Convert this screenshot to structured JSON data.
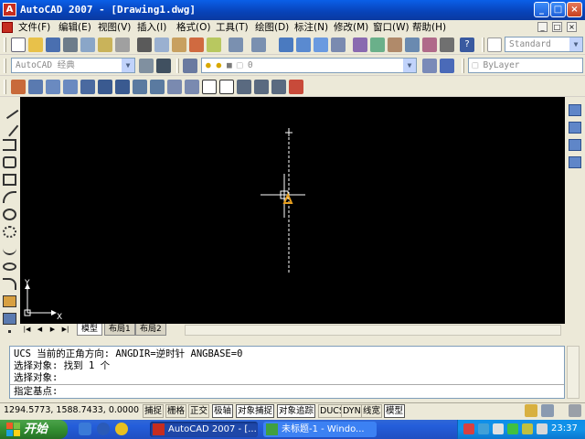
{
  "window": {
    "app_logo": "A",
    "title": "AutoCAD 2007 - [Drawing1.dwg]",
    "minimize": "_",
    "maximize": "□",
    "close": "×"
  },
  "menu": {
    "items": [
      "文件(F)",
      "编辑(E)",
      "视图(V)",
      "插入(I)",
      "格式(O)",
      "工具(T)",
      "绘图(D)",
      "标注(N)",
      "修改(M)",
      "窗口(W)",
      "帮助(H)"
    ],
    "mdi_buttons": [
      "_",
      "□",
      "×"
    ]
  },
  "toolbars": {
    "text_style_value": "Standard",
    "workspace_value": "AutoCAD 经典",
    "layer_value": "0",
    "color_value": "ByLayer"
  },
  "drawing": {
    "ucs_x_label": "X",
    "ucs_y_label": "Y"
  },
  "layout_tabs": {
    "nav": [
      "|◀",
      "◀",
      "▶",
      "▶|"
    ],
    "tabs": [
      "模型",
      "布局1",
      "布局2"
    ],
    "active": "模型"
  },
  "command_window": {
    "lines": [
      "UCS 当前的正角方向:  ANGDIR=逆时针  ANGBASE=0",
      "选择对象: 找到 1 个",
      "选择对象:",
      "指定基点:"
    ]
  },
  "statusbar": {
    "coordinates": "1294.5773, 1588.7433, 0.0000",
    "buttons": [
      {
        "label": "捕捉",
        "on": false
      },
      {
        "label": "栅格",
        "on": false
      },
      {
        "label": "正交",
        "on": false
      },
      {
        "label": "极轴",
        "on": true
      },
      {
        "label": "对象捕捉",
        "on": true
      },
      {
        "label": "对象追踪",
        "on": true
      },
      {
        "label": "DUCS",
        "on": false
      },
      {
        "label": "DYN",
        "on": false
      },
      {
        "label": "线宽",
        "on": false
      },
      {
        "label": "模型",
        "on": true
      }
    ]
  },
  "taskbar": {
    "start_label": "开始",
    "tasks": [
      {
        "label": "AutoCAD 2007 - [...",
        "active": true
      },
      {
        "label": "未标题-1 - Windo...",
        "active": false
      }
    ],
    "clock": "23:37"
  },
  "colors": {
    "title_blue": "#0a5fe8",
    "drawing_bg": "#000000",
    "start_green": "#2f8a2e",
    "taskbar_blue": "#245edb"
  }
}
